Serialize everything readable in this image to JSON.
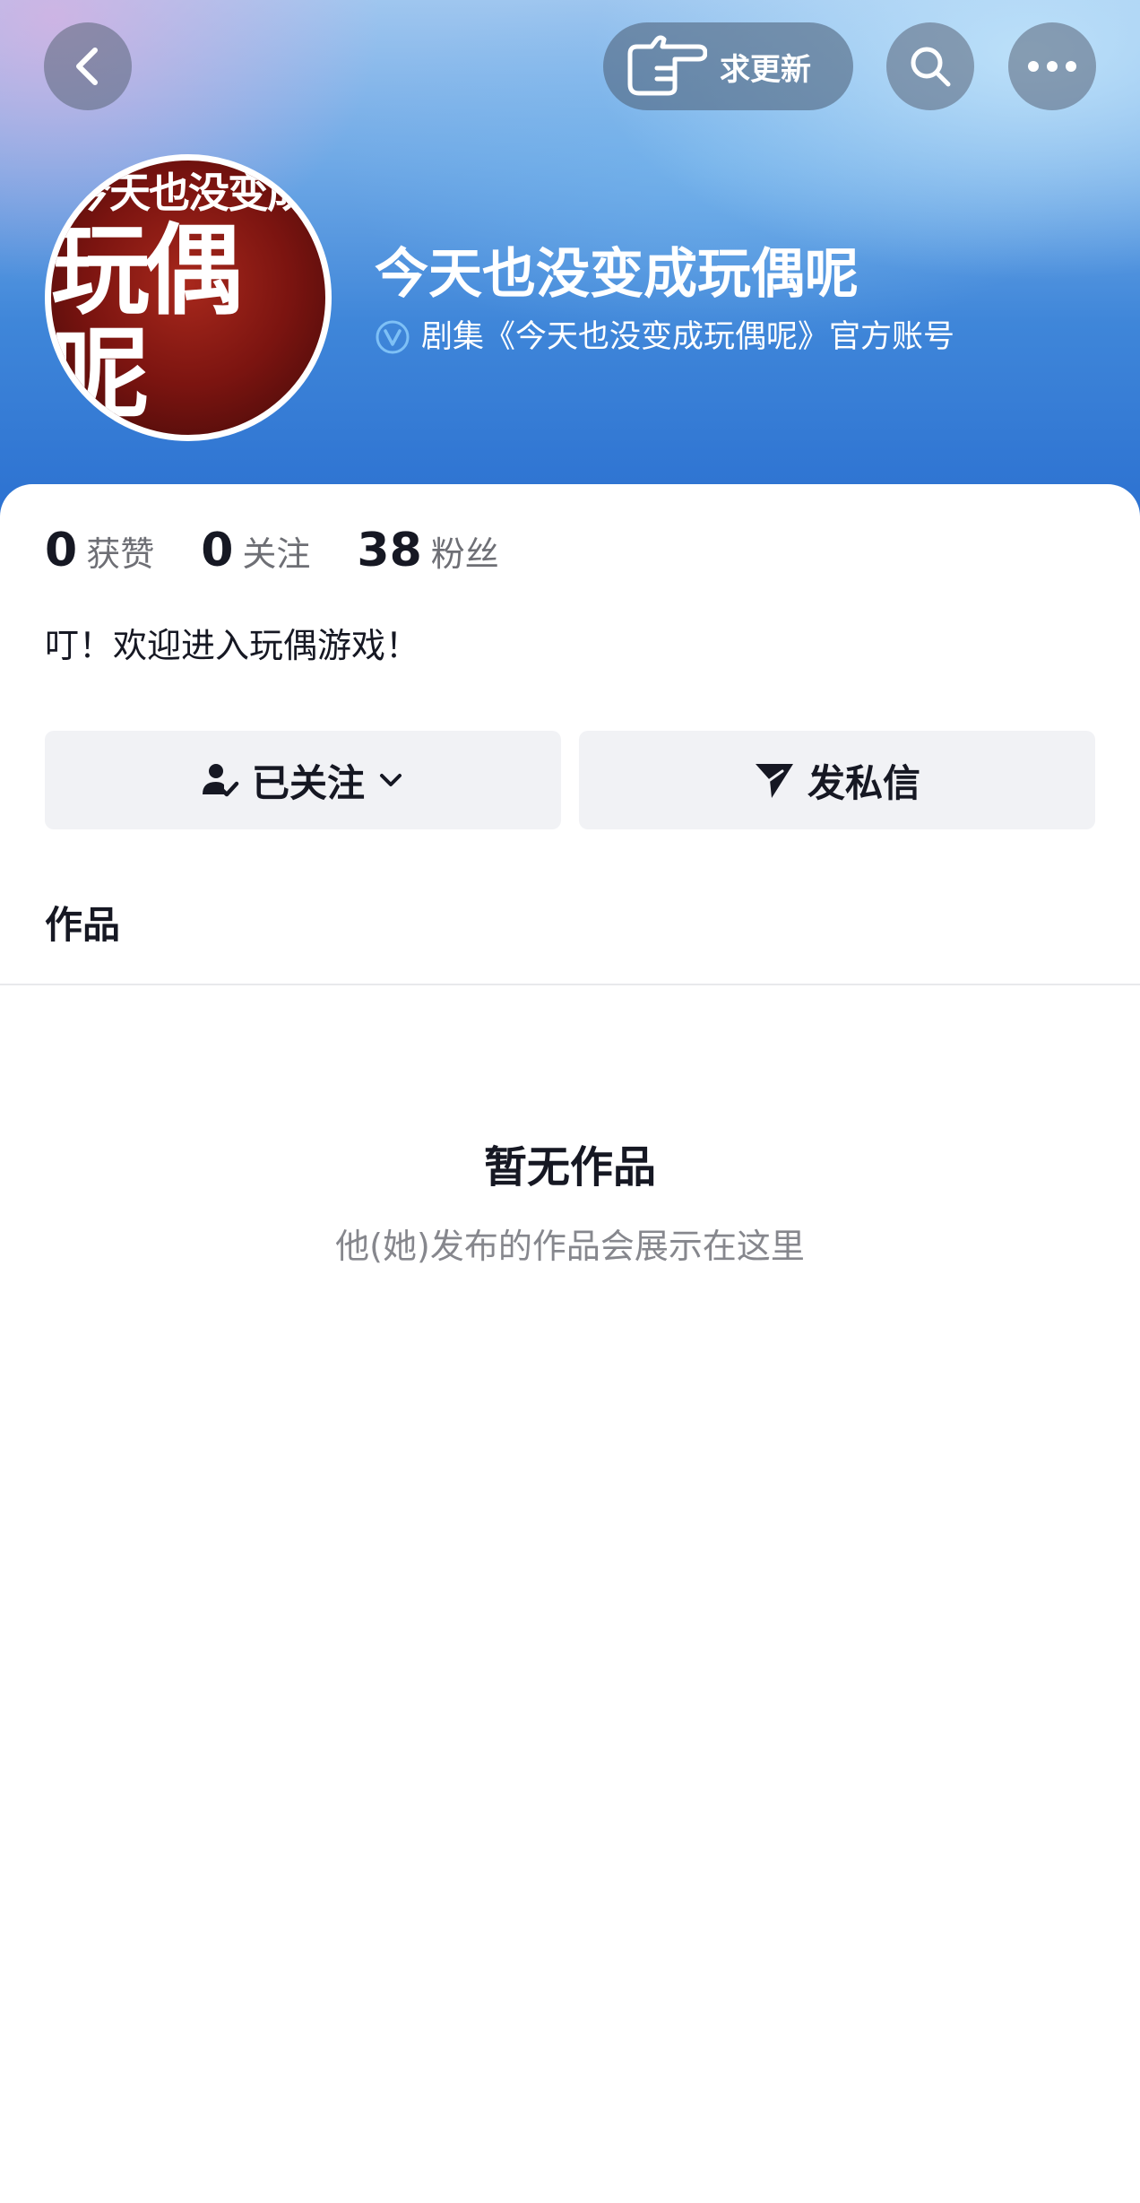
{
  "header": {
    "request_update_label": "求更新"
  },
  "profile": {
    "avatar_text_top": "今天也没变成",
    "avatar_text_bottom": "玩偶呢",
    "name": "今天也没变成玩偶呢",
    "verification": "剧集《今天也没变成玩偶呢》官方账号"
  },
  "stats": [
    {
      "value": "0",
      "label": "获赞"
    },
    {
      "value": "0",
      "label": "关注"
    },
    {
      "value": "38",
      "label": "粉丝"
    }
  ],
  "bio": "叮！欢迎进入玩偶游戏！",
  "actions": {
    "follow_label": "已关注",
    "message_label": "发私信"
  },
  "tabs": {
    "works": "作品"
  },
  "empty_state": {
    "title": "暂无作品",
    "subtitle": "他(她)发布的作品会展示在这里"
  },
  "colors": {
    "banner_blue": "#3f86d9",
    "verify_badge": "#5aa6f0",
    "button_bg": "#f1f2f5",
    "text_primary": "#161823",
    "text_secondary": "#86878d"
  },
  "icons": [
    "back-arrow-icon",
    "pointing-hand-icon",
    "search-icon",
    "more-dots-icon",
    "verified-v-icon",
    "user-check-icon",
    "chevron-down-icon",
    "paper-plane-icon"
  ]
}
